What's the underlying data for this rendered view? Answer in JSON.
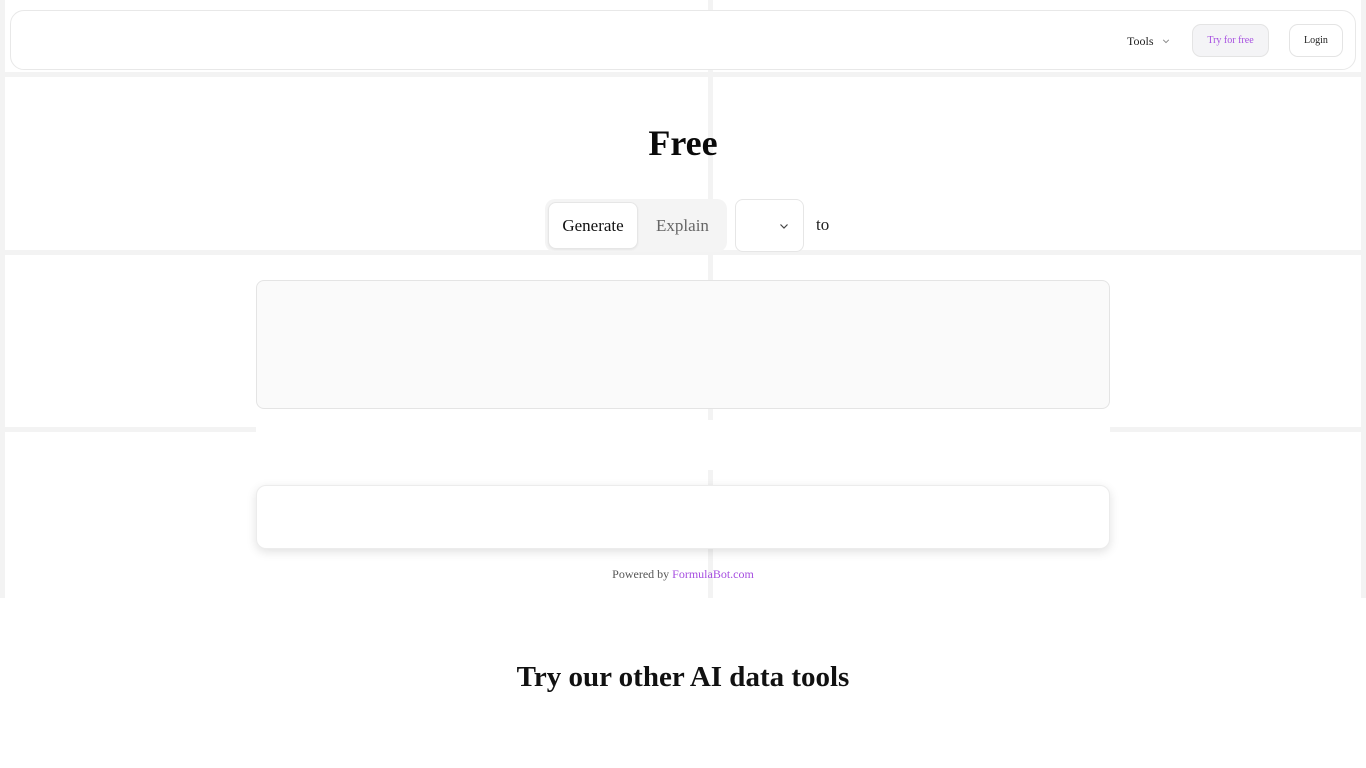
{
  "nav": {
    "tools_label": "Tools",
    "try_label": "Try for free",
    "login_label": "Login"
  },
  "hero": {
    "title": "Free"
  },
  "mode_toggle": {
    "generate_label": "Generate",
    "explain_label": "Explain",
    "selected": "Generate"
  },
  "converter": {
    "to_label": "to"
  },
  "footer": {
    "powered_prefix": "Powered by ",
    "powered_link": "FormulaBot.com"
  },
  "section": {
    "title": "Try our other AI data tools"
  },
  "colors": {
    "accent": "#a64ee0",
    "border": "#e6e6e6",
    "toggle_bg": "#f4f4f4"
  }
}
